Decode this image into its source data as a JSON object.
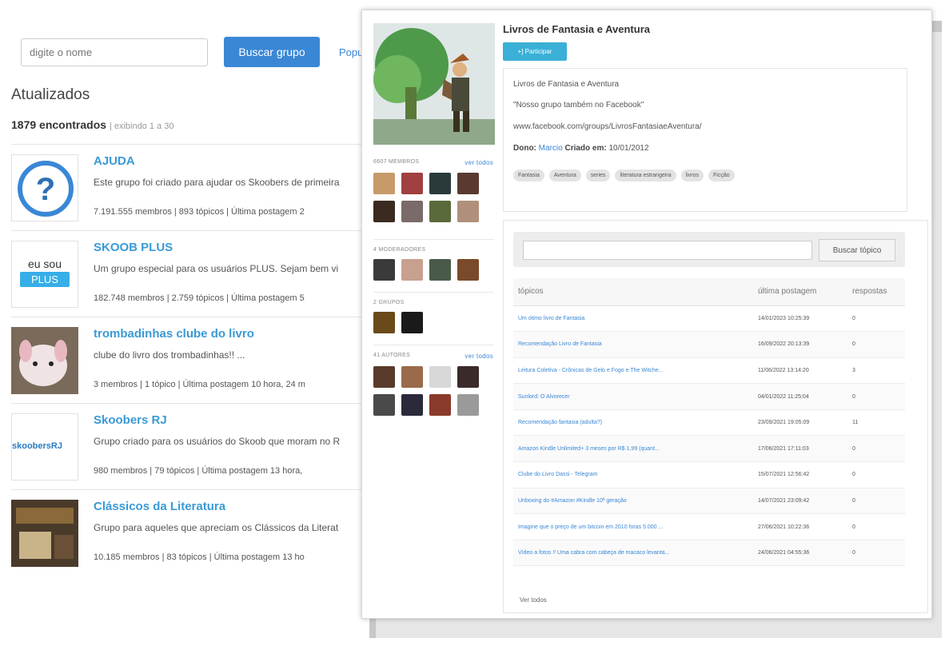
{
  "list": {
    "search_placeholder": "digite o nome",
    "search_button": "Buscar grupo",
    "popular_link": "Popu",
    "heading": "Atualizados",
    "count": "1879 encontrados",
    "count_sub": "| exibindo 1 a 30",
    "groups": [
      {
        "name": "AJUDA",
        "desc": "Este grupo foi criado para ajudar os Skoobers de primeira",
        "stats": "7.191.555 membros  |  893 tópicos  |  Última postagem 2"
      },
      {
        "name": "SKOOB PLUS",
        "desc": "Um grupo especial para os usuários PLUS. Sejam bem vi",
        "stats": "182.748 membros  |  2.759 tópicos  |  Última postagem 5"
      },
      {
        "name": "trombadinhas clube do livro",
        "desc": "clube do livro dos trombadinhas!! ...",
        "stats": "3 membros  |  1 tópico  |  Última postagem 10 hora, 24 m"
      },
      {
        "name": "Skoobers RJ",
        "desc": "Grupo criado para os usuários do Skoob que moram no R",
        "stats": "980 membros  |  79 tópicos  |  Última postagem 13 hora,"
      },
      {
        "name": "Clássicos da Literatura",
        "desc": "Grupo para aqueles que apreciam os Clássicos da Literat",
        "stats": "10.185 membros  |  83 tópicos  |  Última postagem 13 ho"
      }
    ],
    "thumb_texts": {
      "plus_top": "eu sou",
      "plus_bottom": "PLUS",
      "rj": "skoobersRJ"
    }
  },
  "detail": {
    "title": "Livros de Fantasia e Aventura",
    "join_button": "+] Participar",
    "description_lines": [
      "Livros de Fantasia e Aventura",
      "\"Nosso grupo também no Facebook\"",
      "www.facebook.com/groups/LivrosFantasiaeAventura/"
    ],
    "owner_label": "Dono:",
    "owner_name": "Marcio",
    "created_label": "Criado em:",
    "created_date": "10/01/2012",
    "tags": [
      "Fantasia",
      "Aventura",
      "series",
      "literatura estrangeira",
      "livros",
      "Ficção"
    ],
    "sidebar": {
      "members_head": "6607 MEMBROS",
      "members_link": "ver todos",
      "moderators_head": "4 MODERADORES",
      "groups_head": "2 GRUPOS",
      "authors_head": "41 AUTORES",
      "authors_link": "ver todos"
    },
    "topic_search_button": "Buscar tópico",
    "topics_headers": {
      "topic": "tópicos",
      "last": "última postagem",
      "replies": "respostas"
    },
    "topics": [
      {
        "name": "Um ótimo livro de Fantasia",
        "last": "14/01/2023 10:25:39",
        "replies": "0"
      },
      {
        "name": "Recomendação Livro de Fantasia",
        "last": "16/09/2022 20:13:39",
        "replies": "0"
      },
      {
        "name": "Leitura Coletiva - Crônicas de Gelo e Fogo e The Witche...",
        "last": "11/06/2022 13:14:20",
        "replies": "3"
      },
      {
        "name": "Sunlord: O Alvorecer",
        "last": "04/01/2022 11:25:04",
        "replies": "0"
      },
      {
        "name": "Recomendação fantasia (adulta?)",
        "last": "23/09/2021 19:05:09",
        "replies": "11"
      },
      {
        "name": "Amazon Kindle Unlimited+ 3 meses por R$ 1,99 (quant...",
        "last": "17/06/2021 17:11:03",
        "replies": "0"
      },
      {
        "name": "Clube do Livro Dassi - Telegram",
        "last": "15/07/2021 12:56:42",
        "replies": "0"
      },
      {
        "name": "Unboxing do #Amazon #Kindle 10ª geração",
        "last": "14/07/2021 23:09:42",
        "replies": "0"
      },
      {
        "name": "Imagine que o preço de um bitcoin em 2010 foras 5.000 ...",
        "last": "27/06/2021 10:22:36",
        "replies": "0"
      },
      {
        "name": "Vídeo a fotos !! Uma cabra com cabeça de macaco levanta...",
        "last": "24/06/2021 04:55:36",
        "replies": "0"
      }
    ],
    "see_all": "Ver todos"
  }
}
